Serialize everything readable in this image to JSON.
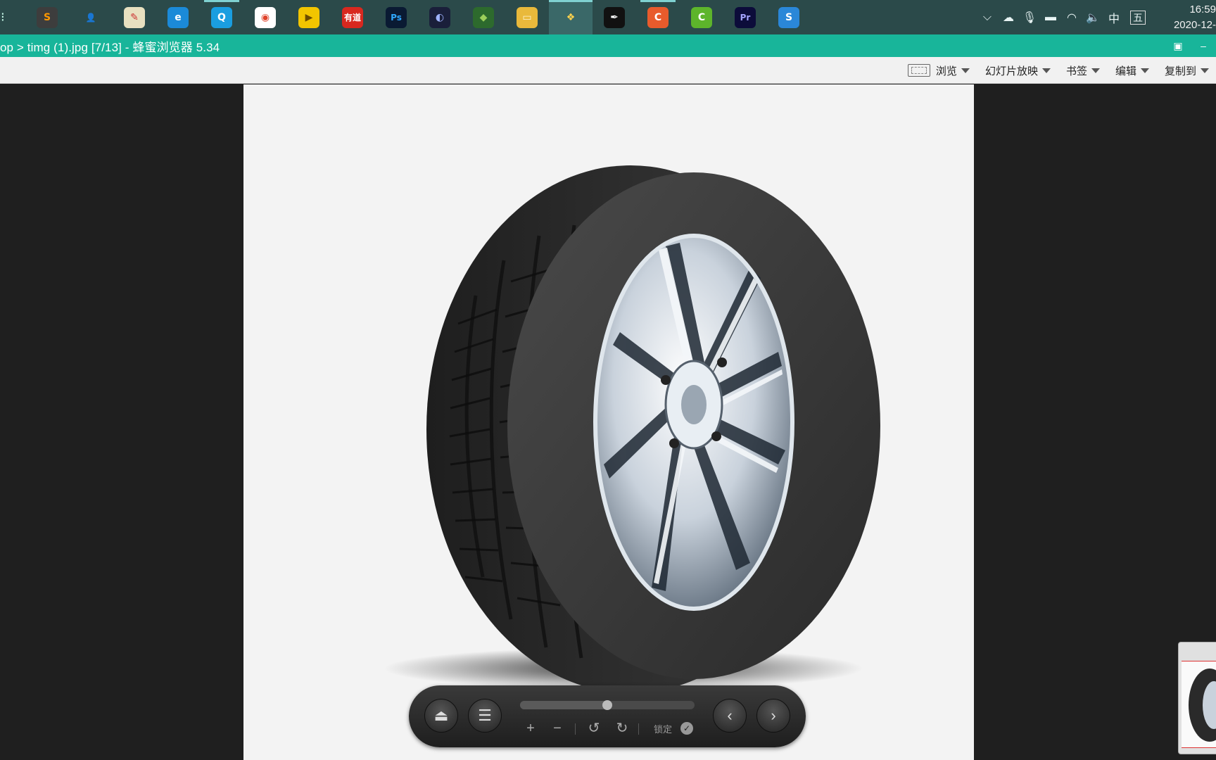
{
  "taskbar": {
    "apps": [
      {
        "name": "sublime-text-icon",
        "glyph": "S",
        "color": "#3d3d3d",
        "fg": "#ff9800"
      },
      {
        "name": "contacts-icon",
        "glyph": "👤",
        "color": "transparent",
        "fg": "#7fb3e6"
      },
      {
        "name": "notes-icon",
        "glyph": "✎",
        "color": "#e8e0c0",
        "fg": "#c33"
      },
      {
        "name": "edge-icon",
        "glyph": "e",
        "color": "#1b8ad8",
        "fg": "#fff"
      },
      {
        "name": "qq-browser-icon",
        "glyph": "Q",
        "color": "#1a9ee0",
        "fg": "#fff"
      },
      {
        "name": "chrome-icon",
        "glyph": "◉",
        "color": "#ffffff",
        "fg": "#e0432b"
      },
      {
        "name": "player-icon",
        "glyph": "▶",
        "color": "#f2c500",
        "fg": "#6a4b00"
      },
      {
        "name": "youdao-icon",
        "glyph": "有道",
        "color": "#d8281f",
        "fg": "#fff"
      },
      {
        "name": "photoshop-icon",
        "glyph": "Ps",
        "color": "#0a1a33",
        "fg": "#2fa8ff"
      },
      {
        "name": "cinema4d-icon",
        "glyph": "◐",
        "color": "#1a1f3a",
        "fg": "#9fb4ff"
      },
      {
        "name": "network-icon",
        "glyph": "◆",
        "color": "#2d6a2d",
        "fg": "#9ccf5a"
      },
      {
        "name": "file-explorer-icon",
        "glyph": "▭",
        "color": "#e9b93b",
        "fg": "#fff4cf"
      },
      {
        "name": "honeyview-icon",
        "glyph": "❖",
        "color": "#3a6868",
        "fg": "#ffd34d"
      },
      {
        "name": "pen-tool-icon",
        "glyph": "✒",
        "color": "#111111",
        "fg": "#fff"
      },
      {
        "name": "camtasia-c-icon",
        "glyph": "C",
        "color": "#e85b2c",
        "fg": "#fff"
      },
      {
        "name": "camtasia-green-icon",
        "glyph": "C",
        "color": "#5db52b",
        "fg": "#fff"
      },
      {
        "name": "premiere-icon",
        "glyph": "Pr",
        "color": "#0c0c3a",
        "fg": "#a3a3ff"
      },
      {
        "name": "sogou-icon",
        "glyph": "S",
        "color": "#2a87d8",
        "fg": "#fff"
      }
    ],
    "tray": {
      "ime_lang": "中",
      "ime_mode": "五",
      "time": "16:59",
      "date": "2020-12-"
    }
  },
  "window": {
    "title": "op > timg (1).jpg [7/13] - 蜂蜜浏览器 5.34"
  },
  "menu": {
    "items": [
      {
        "label": "浏览",
        "name": "menu-browse"
      },
      {
        "label": "幻灯片放映",
        "name": "menu-slideshow"
      },
      {
        "label": "书签",
        "name": "menu-bookmark"
      },
      {
        "label": "编辑",
        "name": "menu-edit"
      },
      {
        "label": "复制到",
        "name": "menu-copy-to"
      }
    ]
  },
  "viewer": {
    "lock_label": "锁定",
    "slider_position": 0.5,
    "colors": {
      "canvas": "#f3f3f3",
      "background": "#1f1f1f",
      "titlebar": "#18b59a",
      "taskbar": "#2b4a4a"
    }
  }
}
